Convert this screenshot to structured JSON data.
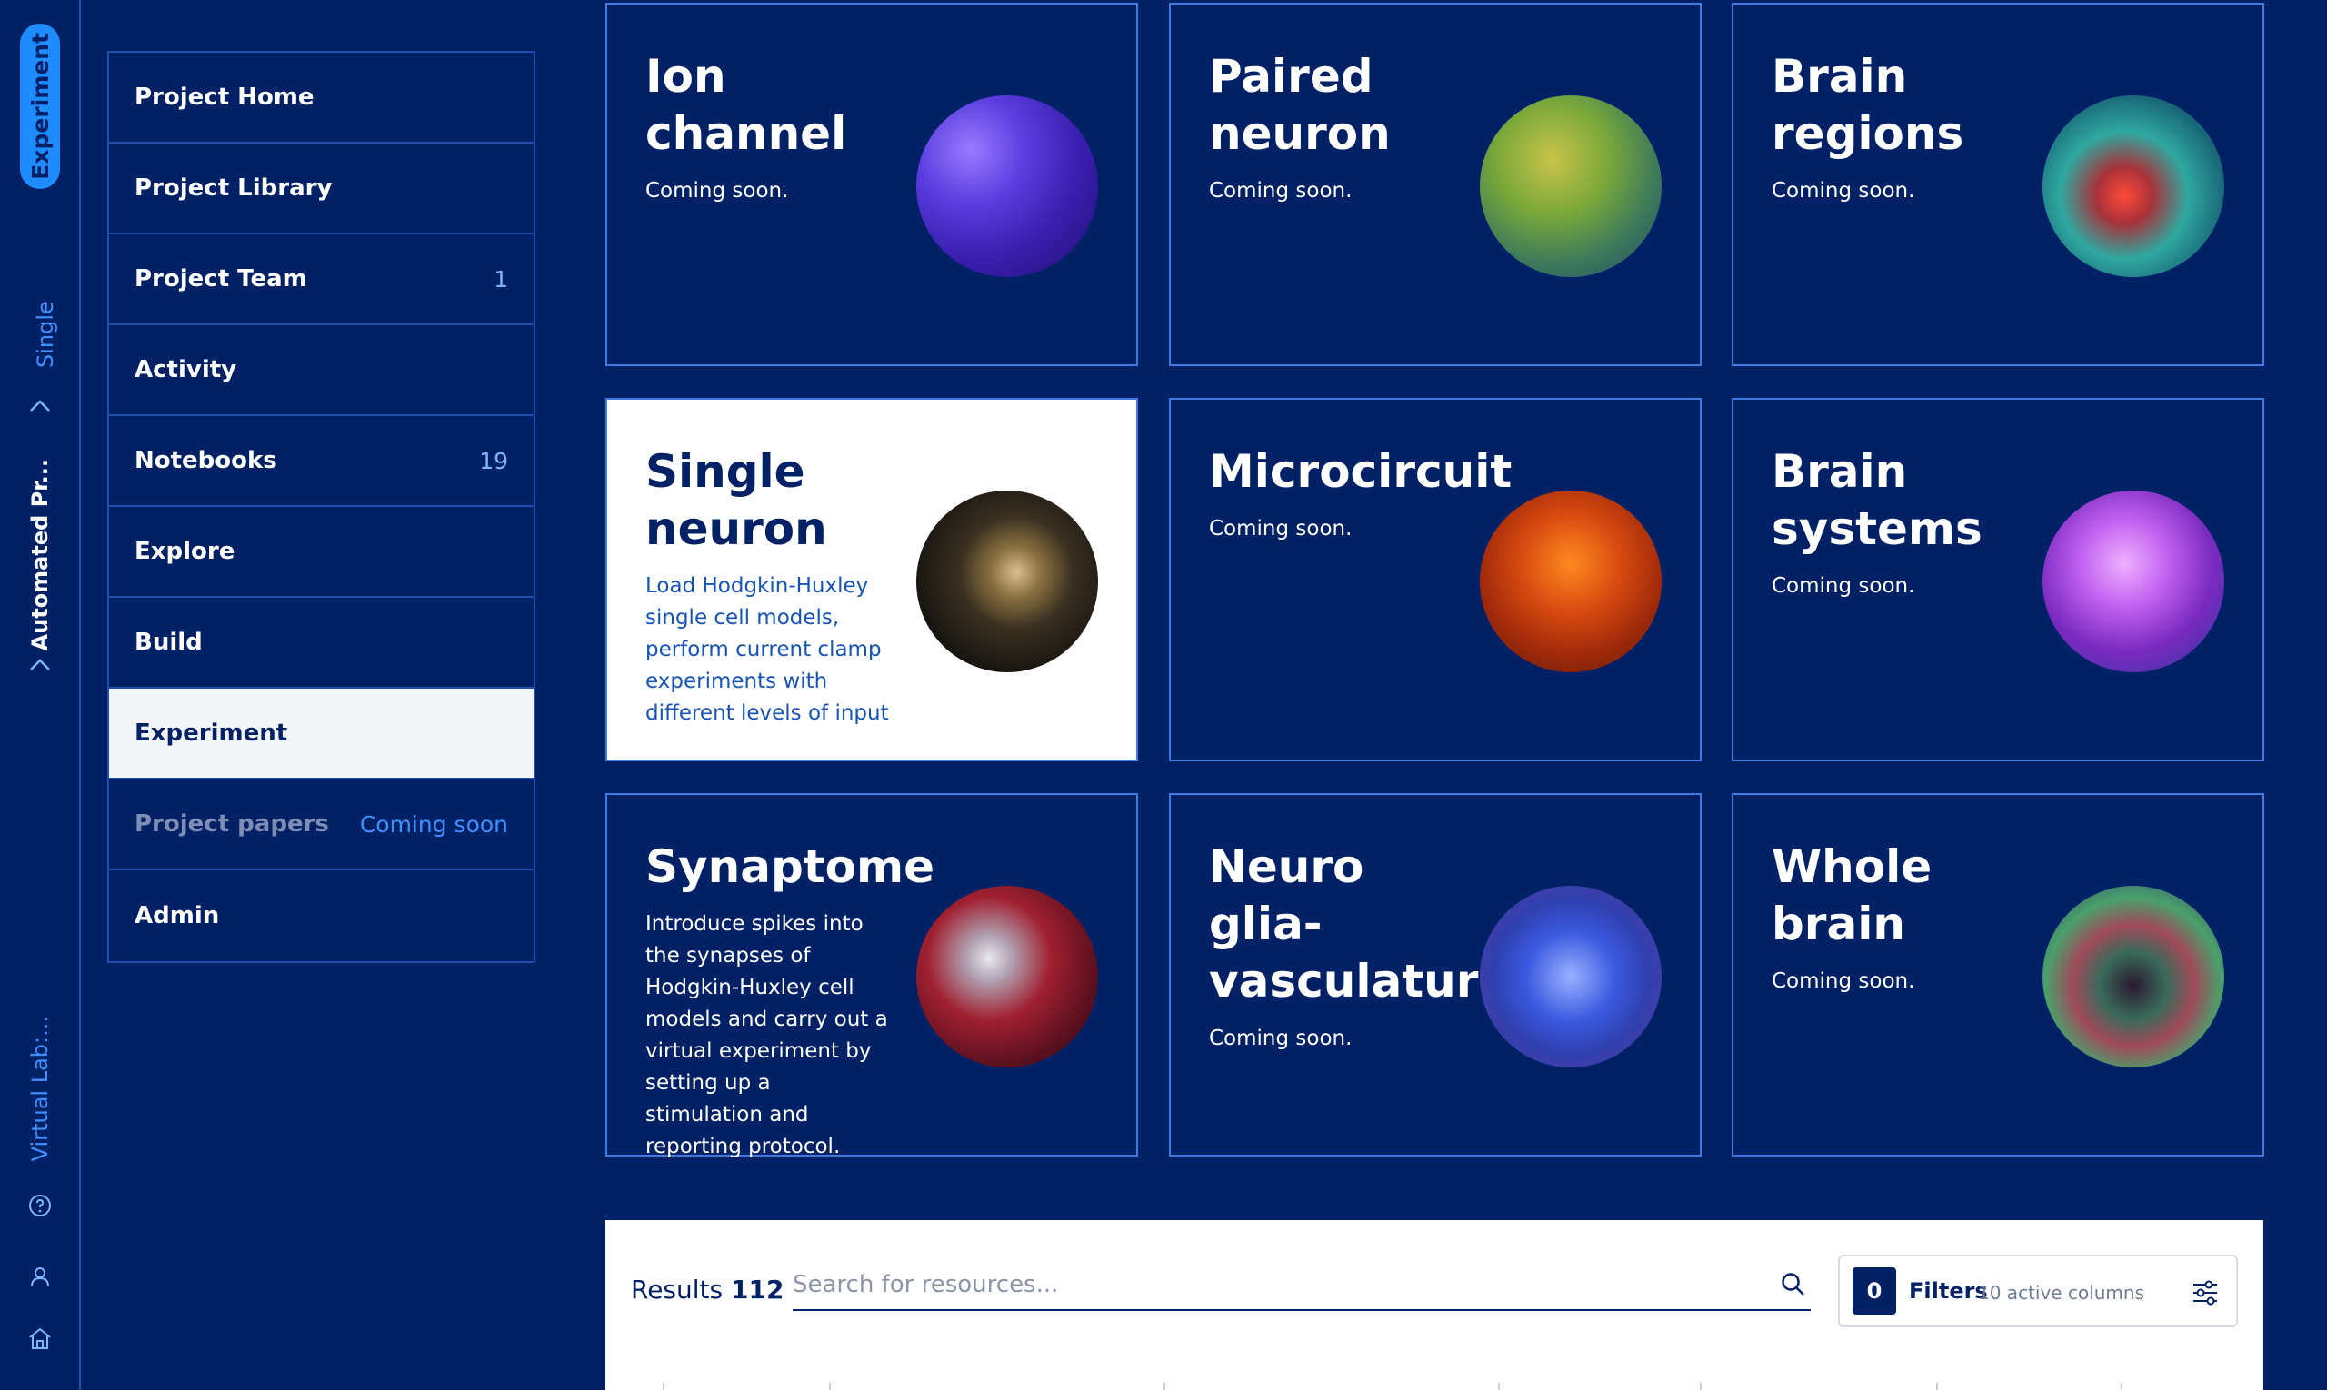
{
  "rail": {
    "experiment_label": "Experiment",
    "single_neuron_label": "Single Neuron",
    "project_label": "Automated Pr...",
    "virtual_lab_label": "Virtual Lab:..."
  },
  "menu": {
    "items": [
      {
        "label": "Project Home",
        "count": ""
      },
      {
        "label": "Project Library",
        "count": ""
      },
      {
        "label": "Project Team",
        "count": "1"
      },
      {
        "label": "Activity",
        "count": ""
      },
      {
        "label": "Notebooks",
        "count": "19"
      },
      {
        "label": "Explore",
        "count": ""
      },
      {
        "label": "Build",
        "count": ""
      },
      {
        "label": "Experiment",
        "count": ""
      },
      {
        "label": "Project papers",
        "count": "Coming soon"
      },
      {
        "label": "Admin",
        "count": ""
      }
    ]
  },
  "cards": [
    {
      "title": "Ion channel",
      "desc": "Coming soon."
    },
    {
      "title": "Paired neuron",
      "desc": "Coming soon."
    },
    {
      "title": "Brain regions",
      "desc": "Coming soon."
    },
    {
      "title": "Single neuron",
      "desc": "Load Hodgkin-Huxley single cell models, perform current clamp experiments with different levels of input current, and observe the"
    },
    {
      "title": "Microcircuit",
      "desc": "Coming soon."
    },
    {
      "title": "Brain systems",
      "desc": "Coming soon."
    },
    {
      "title": "Synaptome",
      "desc": "Introduce spikes into the synapses of Hodgkin-Huxley cell models and carry out a virtual experiment by setting up a stimulation and reporting protocol."
    },
    {
      "title": "Neuro glia-vasculature",
      "desc": "Coming soon."
    },
    {
      "title": "Whole brain",
      "desc": "Coming soon."
    }
  ],
  "results": {
    "label": "Results",
    "count": "112",
    "search_placeholder": "Search for resources...",
    "filter_count": "0",
    "filter_label": "Filters",
    "filter_sub": "10 active columns"
  },
  "colors": {
    "background": "#002166",
    "accent": "#1e8bff",
    "border": "#3d7be0"
  }
}
